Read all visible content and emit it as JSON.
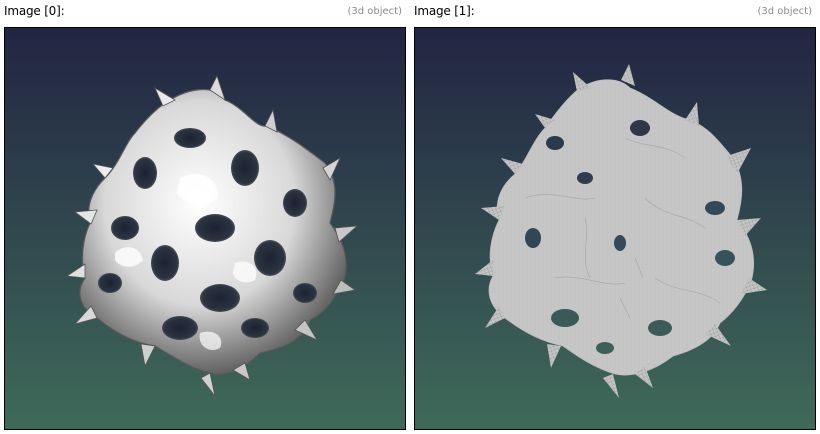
{
  "panels": [
    {
      "title": "Image [0]:",
      "kind": "(3d object)",
      "render_mode": "shaded-surface"
    },
    {
      "title": "Image [1]:",
      "kind": "(3d object)",
      "render_mode": "wireframe-mesh"
    }
  ],
  "colors": {
    "bg_top": "#222543",
    "bg_bottom": "#3f6a59",
    "surface_light": "#ffffff",
    "surface_dark": "#3a3a3a",
    "wire": "#c8c8c8",
    "title_text": "#000000",
    "kind_text": "#8a8a8a"
  },
  "icons": [
    "gyroid-surface-render",
    "gyroid-wireframe-render"
  ]
}
